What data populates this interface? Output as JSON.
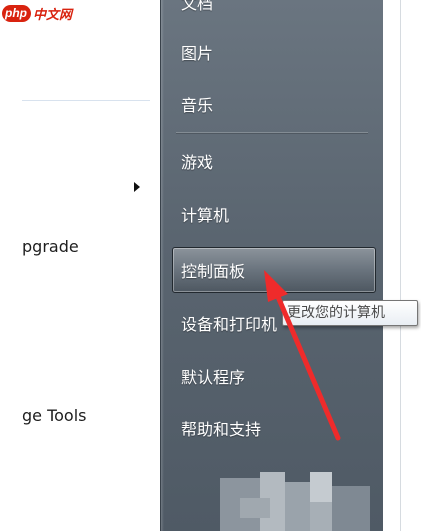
{
  "watermark": {
    "badge": "php",
    "text": "中文网"
  },
  "left_menu": {
    "items": [
      "pgrade",
      "ge Tools"
    ]
  },
  "right_menu": {
    "items": [
      {
        "label": "文档"
      },
      {
        "label": "图片"
      },
      {
        "label": "音乐"
      },
      {
        "label": "游戏"
      },
      {
        "label": "计算机"
      },
      {
        "label": "控制面板",
        "selected": true
      },
      {
        "label": "设备和打印机"
      },
      {
        "label": "默认程序"
      },
      {
        "label": "帮助和支持"
      }
    ]
  },
  "tooltip": {
    "text": "更改您的计算机"
  },
  "colors": {
    "panel": "#5f6a75",
    "arrow": "#ef2b2b",
    "logo": "#d9230f"
  }
}
